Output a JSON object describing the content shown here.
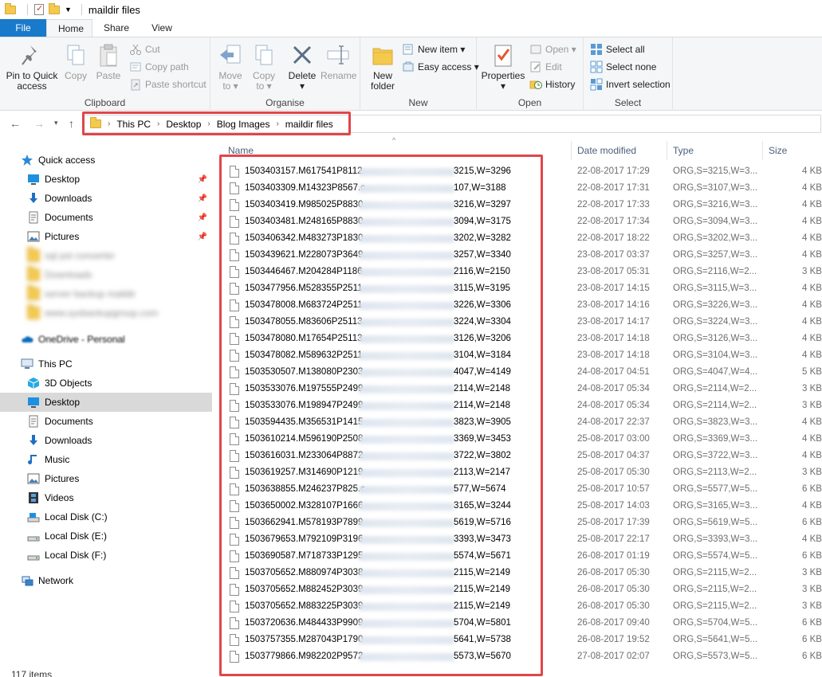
{
  "window": {
    "title": "maildir files"
  },
  "tabs": {
    "file": "File",
    "home": "Home",
    "share": "Share",
    "view": "View"
  },
  "ribbon": {
    "clipboard": {
      "label": "Clipboard",
      "pin": "Pin to Quick\naccess",
      "pin_l1": "Pin to Quick",
      "pin_l2": "access",
      "copy": "Copy",
      "paste": "Paste",
      "cut": "Cut",
      "copy_path": "Copy path",
      "paste_shortcut": "Paste shortcut"
    },
    "organise": {
      "label": "Organise",
      "move_l1": "Move",
      "move_l2": "to ▾",
      "copy_l1": "Copy",
      "copy_l2": "to ▾",
      "delete_l1": "Delete",
      "delete_l2": "▾",
      "rename": "Rename"
    },
    "new": {
      "label": "New",
      "new_folder_l1": "New",
      "new_folder_l2": "folder",
      "new_item": "New item ▾",
      "easy_access": "Easy access ▾"
    },
    "open": {
      "label": "Open",
      "properties_l1": "Properties",
      "properties_l2": "▾",
      "open": "Open ▾",
      "edit": "Edit",
      "history": "History"
    },
    "select": {
      "label": "Select",
      "select_all": "Select all",
      "select_none": "Select none",
      "invert": "Invert selection"
    }
  },
  "breadcrumb": [
    "This PC",
    "Desktop",
    "Blog Images",
    "maildir files"
  ],
  "nav": {
    "quick_access": "Quick access",
    "quick_items": [
      "Desktop",
      "Downloads",
      "Documents",
      "Pictures"
    ],
    "blurred_items": [
      "sql pst converter",
      "Downloads",
      "server backup maildir",
      "www.sysbackupgroup.com"
    ],
    "onedrive": "OneDrive - Personal",
    "this_pc": "This PC",
    "pc_items": [
      "3D Objects",
      "Desktop",
      "Documents",
      "Downloads",
      "Music",
      "Pictures",
      "Videos",
      "Local Disk (C:)",
      "Local Disk (E:)",
      "Local Disk (F:)"
    ],
    "network": "Network",
    "status": "117 items"
  },
  "columns": {
    "name": "Name",
    "date": "Date modified",
    "type": "Type",
    "size": "Size"
  },
  "files": [
    {
      "pre": "1503403157.M617541P8112.",
      "suf": "3215,W=3296",
      "date": "22-08-2017 17:29",
      "type": "ORG,S=3215,W=3...",
      "size": "4 KB"
    },
    {
      "pre": "1503403309.M14323P8567.c",
      "suf": "107,W=3188",
      "date": "22-08-2017 17:31",
      "type": "ORG,S=3107,W=3...",
      "size": "4 KB"
    },
    {
      "pre": "1503403419.M985025P8830.",
      "suf": "3216,W=3297",
      "date": "22-08-2017 17:33",
      "type": "ORG,S=3216,W=3...",
      "size": "4 KB"
    },
    {
      "pre": "1503403481.M248165P8830.",
      "suf": "3094,W=3175",
      "date": "22-08-2017 17:34",
      "type": "ORG,S=3094,W=3...",
      "size": "4 KB"
    },
    {
      "pre": "1503406342.M483273P1830",
      "suf": "3202,W=3282",
      "date": "22-08-2017 18:22",
      "type": "ORG,S=3202,W=3...",
      "size": "4 KB"
    },
    {
      "pre": "1503439621.M228073P3649.",
      "suf": "3257,W=3340",
      "date": "23-08-2017 03:37",
      "type": "ORG,S=3257,W=3...",
      "size": "4 KB"
    },
    {
      "pre": "1503446467.M204284P1186",
      "suf": "2116,W=2150",
      "date": "23-08-2017 05:31",
      "type": "ORG,S=2116,W=2...",
      "size": "3 KB"
    },
    {
      "pre": "1503477956.M528355P2511",
      "suf": "3115,W=3195",
      "date": "23-08-2017 14:15",
      "type": "ORG,S=3115,W=3...",
      "size": "4 KB"
    },
    {
      "pre": "1503478008.M683724P2511",
      "suf": "3226,W=3306",
      "date": "23-08-2017 14:16",
      "type": "ORG,S=3226,W=3...",
      "size": "4 KB"
    },
    {
      "pre": "1503478055.M83606P25113.",
      "suf": "3224,W=3304",
      "date": "23-08-2017 14:17",
      "type": "ORG,S=3224,W=3...",
      "size": "4 KB"
    },
    {
      "pre": "1503478080.M17654P25113.",
      "suf": "3126,W=3206",
      "date": "23-08-2017 14:18",
      "type": "ORG,S=3126,W=3...",
      "size": "4 KB"
    },
    {
      "pre": "1503478082.M589632P2511",
      "suf": "3104,W=3184",
      "date": "23-08-2017 14:18",
      "type": "ORG,S=3104,W=3...",
      "size": "4 KB"
    },
    {
      "pre": "1503530507.M138080P2303",
      "suf": "4047,W=4149",
      "date": "24-08-2017 04:51",
      "type": "ORG,S=4047,W=4...",
      "size": "5 KB"
    },
    {
      "pre": "1503533076.M197555P2499",
      "suf": "2114,W=2148",
      "date": "24-08-2017 05:34",
      "type": "ORG,S=2114,W=2...",
      "size": "3 KB"
    },
    {
      "pre": "1503533076.M198947P2499",
      "suf": "2114,W=2148",
      "date": "24-08-2017 05:34",
      "type": "ORG,S=2114,W=2...",
      "size": "3 KB"
    },
    {
      "pre": "1503594435.M356531P1415",
      "suf": "3823,W=3905",
      "date": "24-08-2017 22:37",
      "type": "ORG,S=3823,W=3...",
      "size": "4 KB"
    },
    {
      "pre": "1503610214.M596190P2508",
      "suf": "3369,W=3453",
      "date": "25-08-2017 03:00",
      "type": "ORG,S=3369,W=3...",
      "size": "4 KB"
    },
    {
      "pre": "1503616031.M233064P8872",
      "suf": "3722,W=3802",
      "date": "25-08-2017 04:37",
      "type": "ORG,S=3722,W=3...",
      "size": "4 KB"
    },
    {
      "pre": "1503619257.M314690P1219",
      "suf": "2113,W=2147",
      "date": "25-08-2017 05:30",
      "type": "ORG,S=2113,W=2...",
      "size": "3 KB"
    },
    {
      "pre": "1503638855.M246237P825.c",
      "suf": "577,W=5674",
      "date": "25-08-2017 10:57",
      "type": "ORG,S=5577,W=5...",
      "size": "6 KB"
    },
    {
      "pre": "1503650002.M328107P1666",
      "suf": "3165,W=3244",
      "date": "25-08-2017 14:03",
      "type": "ORG,S=3165,W=3...",
      "size": "4 KB"
    },
    {
      "pre": "1503662941.M578193P7899",
      "suf": "5619,W=5716",
      "date": "25-08-2017 17:39",
      "type": "ORG,S=5619,W=5...",
      "size": "6 KB"
    },
    {
      "pre": "1503679653.M792109P3196",
      "suf": "3393,W=3473",
      "date": "25-08-2017 22:17",
      "type": "ORG,S=3393,W=3...",
      "size": "4 KB"
    },
    {
      "pre": "1503690587.M718733P1295",
      "suf": "5574,W=5671",
      "date": "26-08-2017 01:19",
      "type": "ORG,S=5574,W=5...",
      "size": "6 KB"
    },
    {
      "pre": "1503705652.M880974P3038",
      "suf": "2115,W=2149",
      "date": "26-08-2017 05:30",
      "type": "ORG,S=2115,W=2...",
      "size": "3 KB"
    },
    {
      "pre": "1503705652.M882452P3039",
      "suf": "2115,W=2149",
      "date": "26-08-2017 05:30",
      "type": "ORG,S=2115,W=2...",
      "size": "3 KB"
    },
    {
      "pre": "1503705652.M883225P3039",
      "suf": "2115,W=2149",
      "date": "26-08-2017 05:30",
      "type": "ORG,S=2115,W=2...",
      "size": "3 KB"
    },
    {
      "pre": "1503720636.M484433P9909",
      "suf": "5704,W=5801",
      "date": "26-08-2017 09:40",
      "type": "ORG,S=5704,W=5...",
      "size": "6 KB"
    },
    {
      "pre": "1503757355.M287043P1790",
      "suf": "5641,W=5738",
      "date": "26-08-2017 19:52",
      "type": "ORG,S=5641,W=5...",
      "size": "6 KB"
    },
    {
      "pre": "1503779866.M982202P9572",
      "suf": "5573,W=5670",
      "date": "27-08-2017 02:07",
      "type": "ORG,S=5573,W=5...",
      "size": "6 KB"
    }
  ],
  "colors": {
    "file_tab": "#1979ca",
    "highlight": "#e0464a",
    "selected_nav": "#d9d9d9"
  }
}
